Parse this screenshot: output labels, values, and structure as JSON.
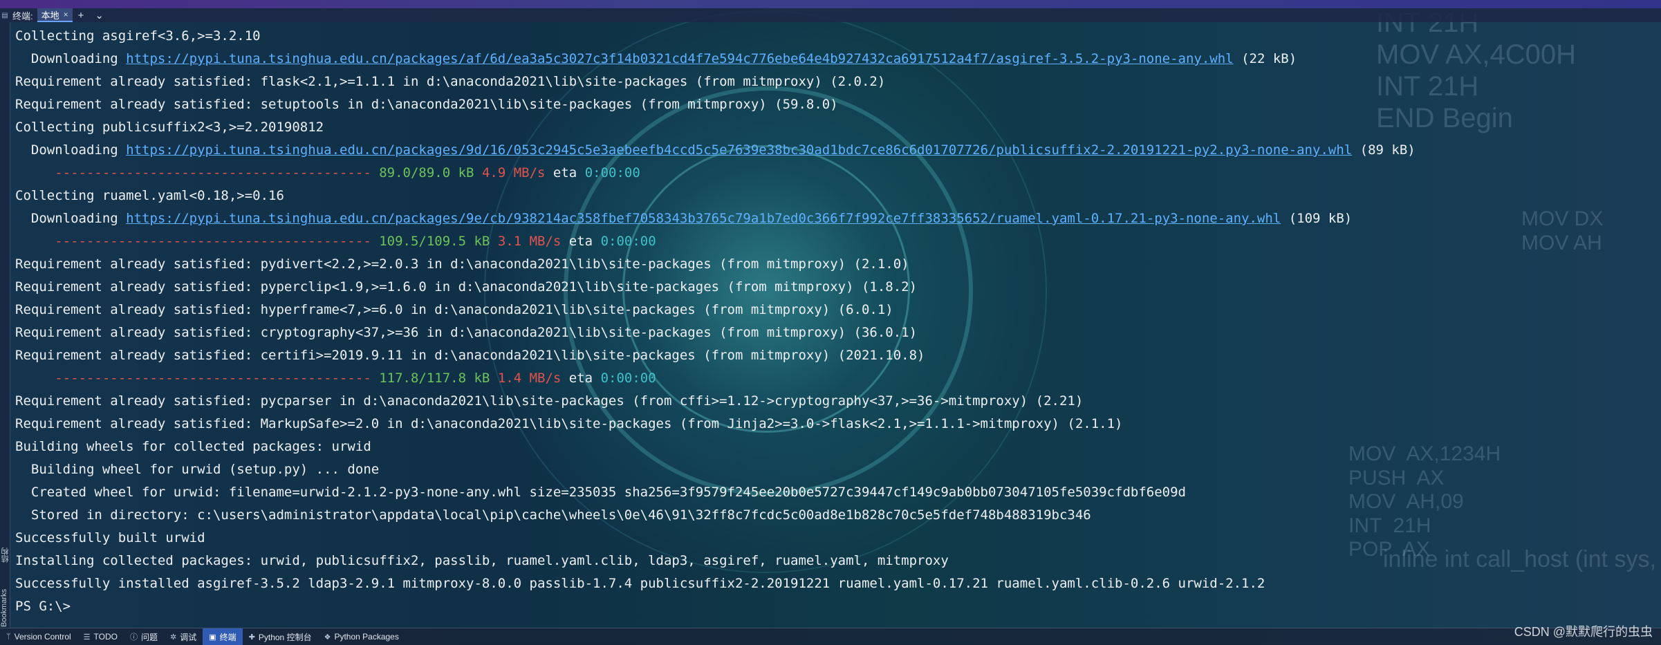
{
  "window": {
    "terminal_label": "终端:",
    "tab_label": "本地",
    "tab_close": "×",
    "new_tab": "+",
    "tab_menu": "⌄"
  },
  "gutter": {
    "structure_label": "结构",
    "bookmarks_label": "Bookmarks"
  },
  "terminal": {
    "lines": [
      {
        "t": "Collecting asgiref<3.6,>=3.2.10"
      },
      {
        "t": "  Downloading ",
        "url": "https://pypi.tuna.tsinghua.edu.cn/packages/af/6d/ea3a5c3027c3f14b0321cd4f7e594c776ebe64e4b927432ca6917512a4f7/asgiref-3.5.2-py3-none-any.whl",
        "tail": " (22 kB)"
      },
      {
        "t": "Requirement already satisfied: flask<2.1,>=1.1.1 in d:\\anaconda2021\\lib\\site-packages (from mitmproxy) (2.0.2)"
      },
      {
        "t": "Requirement already satisfied: setuptools in d:\\anaconda2021\\lib\\site-packages (from mitmproxy) (59.8.0)"
      },
      {
        "t": "Collecting publicsuffix2<3,>=2.20190812"
      },
      {
        "t": "  Downloading ",
        "url": "https://pypi.tuna.tsinghua.edu.cn/packages/9d/16/053c2945c5e3aebeefb4ccd5c5e7639e38bc30ad1bdc7ce86c6d01707726/publicsuffix2-2.20191221-py2.py3-none-any.whl",
        "tail": " (89 kB)"
      },
      {
        "progress": {
          "bar": "     ---------------------------------------- ",
          "size": "89.0/89.0 kB",
          "speed": "4.9 MB/s",
          "eta_label": "eta",
          "eta": "0:00:00"
        }
      },
      {
        "t": "Collecting ruamel.yaml<0.18,>=0.16"
      },
      {
        "t": "  Downloading ",
        "url": "https://pypi.tuna.tsinghua.edu.cn/packages/9e/cb/938214ac358fbef7058343b3765c79a1b7ed0c366f7f992ce7ff38335652/ruamel.yaml-0.17.21-py3-none-any.whl",
        "tail": " (109 kB)"
      },
      {
        "progress": {
          "bar": "     ---------------------------------------- ",
          "size": "109.5/109.5 kB",
          "speed": "3.1 MB/s",
          "eta_label": "eta",
          "eta": "0:00:00"
        }
      },
      {
        "t": "Requirement already satisfied: pydivert<2.2,>=2.0.3 in d:\\anaconda2021\\lib\\site-packages (from mitmproxy) (2.1.0)"
      },
      {
        "t": "Requirement already satisfied: pyperclip<1.9,>=1.6.0 in d:\\anaconda2021\\lib\\site-packages (from mitmproxy) (1.8.2)"
      },
      {
        "t": "Requirement already satisfied: hyperframe<7,>=6.0 in d:\\anaconda2021\\lib\\site-packages (from mitmproxy) (6.0.1)"
      },
      {
        "t": "Requirement already satisfied: cryptography<37,>=36 in d:\\anaconda2021\\lib\\site-packages (from mitmproxy) (36.0.1)"
      },
      {
        "t": "Requirement already satisfied: certifi>=2019.9.11 in d:\\anaconda2021\\lib\\site-packages (from mitmproxy) (2021.10.8)"
      },
      {
        "progress": {
          "bar": "     ---------------------------------------- ",
          "size": "117.8/117.8 kB",
          "speed": "1.4 MB/s",
          "eta_label": "eta",
          "eta": "0:00:00"
        }
      },
      {
        "t": "Requirement already satisfied: pycparser in d:\\anaconda2021\\lib\\site-packages (from cffi>=1.12->cryptography<37,>=36->mitmproxy) (2.21)"
      },
      {
        "t": "Requirement already satisfied: MarkupSafe>=2.0 in d:\\anaconda2021\\lib\\site-packages (from Jinja2>=3.0->flask<2.1,>=1.1.1->mitmproxy) (2.1.1)"
      },
      {
        "t": "Building wheels for collected packages: urwid"
      },
      {
        "t": "  Building wheel for urwid (setup.py) ... done"
      },
      {
        "t": "  Created wheel for urwid: filename=urwid-2.1.2-py3-none-any.whl size=235035 sha256=3f9579f245ee20b0e5727c39447cf149c9ab0bb073047105fe5039cfdbf6e09d"
      },
      {
        "t": "  Stored in directory: c:\\users\\administrator\\appdata\\local\\pip\\cache\\wheels\\0e\\46\\91\\32ff8c7fcdc5c00ad8e1b828c70c5e5fdef748b488319bc346"
      },
      {
        "t": "Successfully built urwid"
      },
      {
        "t": "Installing collected packages: urwid, publicsuffix2, passlib, ruamel.yaml.clib, ldap3, asgiref, ruamel.yaml, mitmproxy"
      },
      {
        "t": "Successfully installed asgiref-3.5.2 ldap3-2.9.1 mitmproxy-8.0.0 passlib-1.7.4 publicsuffix2-2.20191221 ruamel.yaml-0.17.21 ruamel.yaml.clib-0.2.6 urwid-2.1.2"
      },
      {
        "t": "PS G:\\>"
      }
    ]
  },
  "statusbar": {
    "items": [
      {
        "label": "Version Control",
        "icon": "branch-icon",
        "glyph": "ᛘ",
        "active": false
      },
      {
        "label": "TODO",
        "icon": "list-icon",
        "glyph": "☰",
        "active": false
      },
      {
        "label": "问题",
        "icon": "problems-icon",
        "glyph": "ⓘ",
        "active": false
      },
      {
        "label": "调试",
        "icon": "debug-icon",
        "glyph": "✲",
        "active": false
      },
      {
        "label": "终端",
        "icon": "terminal-icon",
        "glyph": "▣",
        "active": true
      },
      {
        "label": "Python 控制台",
        "icon": "python-console-icon",
        "glyph": "✚",
        "active": false
      },
      {
        "label": "Python Packages",
        "icon": "packages-icon",
        "glyph": "❖",
        "active": false
      }
    ]
  },
  "watermark": "CSDN @默默爬行的虫虫",
  "colors": {
    "url": "#5fb0ff",
    "progress_size": "#6ec25b",
    "progress_speed": "#e0534f",
    "progress_eta": "#3fc1c9",
    "active_tab": "#2f5bb5"
  }
}
